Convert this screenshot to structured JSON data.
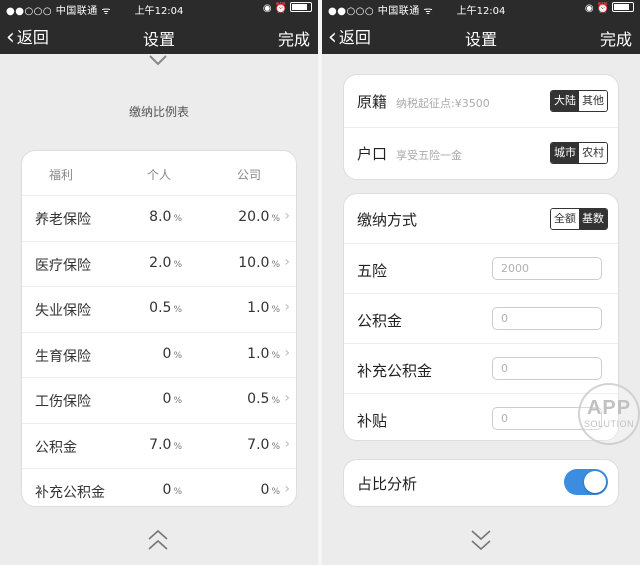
{
  "status_bar": {
    "carrier": "●●○○○ 中国联通 ᯤ",
    "time": "上午12:04",
    "icons": [
      "rotation-lock-icon",
      "alarm-icon",
      "battery-icon"
    ]
  },
  "nav": {
    "back_label": "返回",
    "title": "设置",
    "done_label": "完成"
  },
  "ratio_table": {
    "caption": "缴纳比例表",
    "headers": [
      "福利",
      "个人",
      "公司"
    ],
    "rows": [
      {
        "name": "养老保险",
        "personal": "8.0",
        "company": "20.0",
        "unit": "%"
      },
      {
        "name": "医疗保险",
        "personal": "2.0",
        "company": "10.0",
        "unit": "%"
      },
      {
        "name": "失业保险",
        "personal": "0.5",
        "company": "1.0",
        "unit": "%"
      },
      {
        "name": "生育保险",
        "personal": "0",
        "company": "1.0",
        "unit": "%"
      },
      {
        "name": "工伤保险",
        "personal": "0",
        "company": "0.5",
        "unit": "%"
      },
      {
        "name": "公积金",
        "personal": "7.0",
        "company": "7.0",
        "unit": "%"
      },
      {
        "name": "补充公积金",
        "personal": "0",
        "company": "0",
        "unit": "%"
      }
    ]
  },
  "settings": {
    "origin": {
      "label": "原籍",
      "hint": "纳税起征点:¥3500",
      "options": [
        "大陆",
        "其他"
      ],
      "selected": "大陆"
    },
    "hukou": {
      "label": "户口",
      "hint": "享受五险一金",
      "options": [
        "城市",
        "农村"
      ],
      "selected": "城市"
    },
    "payment_method": {
      "label": "缴纳方式",
      "options": [
        "全额",
        "基数"
      ],
      "selected": "基数"
    },
    "fields": [
      {
        "label": "五险",
        "placeholder": "2000"
      },
      {
        "label": "公积金",
        "placeholder": "0"
      },
      {
        "label": "补充公积金",
        "placeholder": "0"
      },
      {
        "label": "补贴",
        "placeholder": "0"
      }
    ],
    "ratio_analysis": {
      "label": "占比分析",
      "enabled": true
    }
  },
  "watermark": {
    "line1": "APP",
    "line2": "SOLUTION"
  },
  "colors": {
    "nav_background": "#2b2b2b",
    "toggle_on": "#3b8de0",
    "segment_active": "#333333"
  }
}
